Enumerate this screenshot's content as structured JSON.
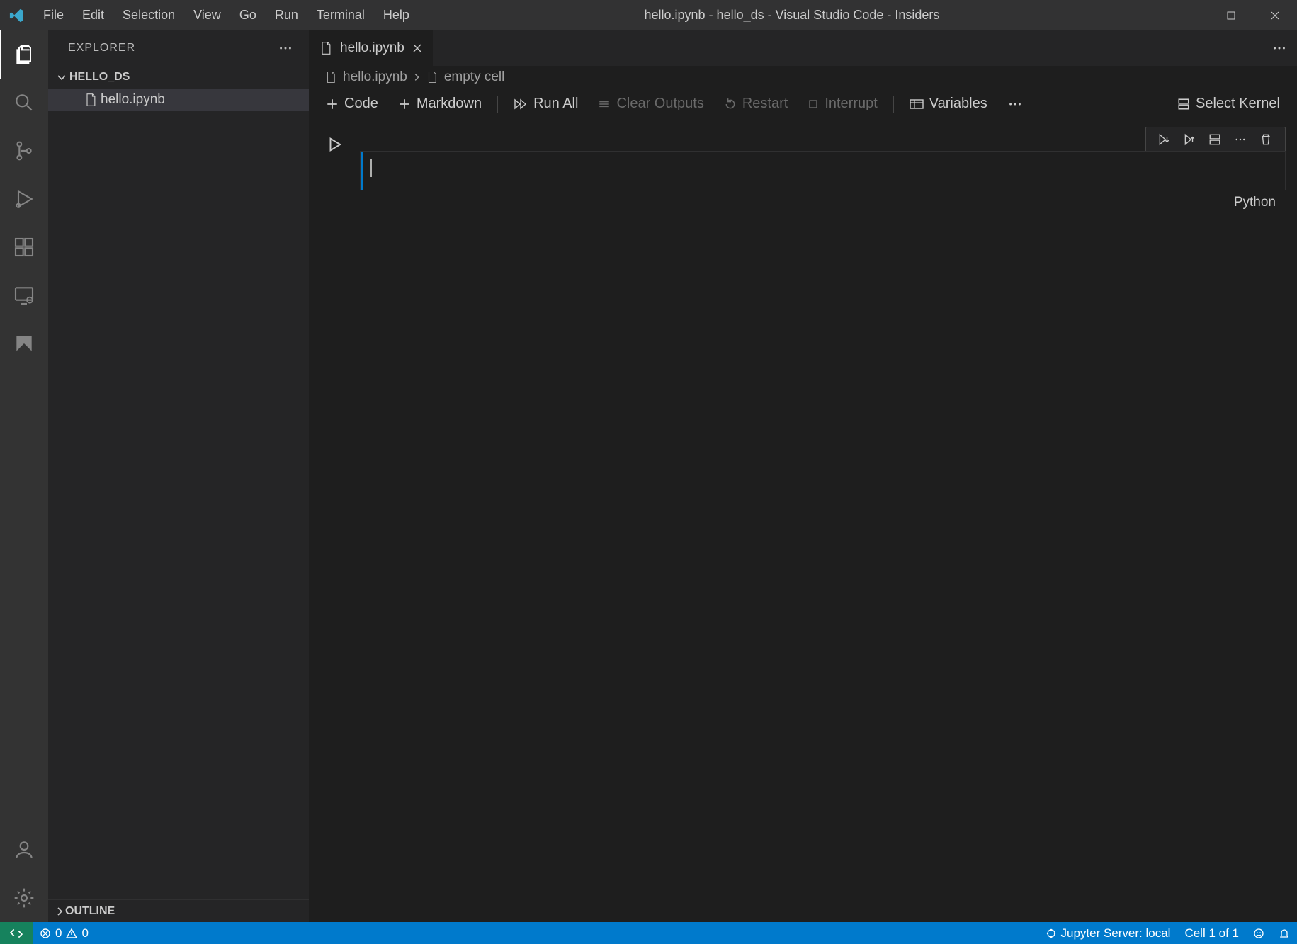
{
  "titlebar": {
    "menus": [
      "File",
      "Edit",
      "Selection",
      "View",
      "Go",
      "Run",
      "Terminal",
      "Help"
    ],
    "title": "hello.ipynb - hello_ds - Visual Studio Code - Insiders"
  },
  "sidebar": {
    "header": "EXPLORER",
    "folder": "HELLO_DS",
    "files": [
      "hello.ipynb"
    ],
    "outline": "OUTLINE"
  },
  "tab": {
    "label": "hello.ipynb"
  },
  "breadcrumb": {
    "file": "hello.ipynb",
    "cell": "empty cell"
  },
  "nbToolbar": {
    "code": "Code",
    "markdown": "Markdown",
    "runAll": "Run All",
    "clearOutputs": "Clear Outputs",
    "restart": "Restart",
    "interrupt": "Interrupt",
    "variables": "Variables",
    "selectKernel": "Select Kernel"
  },
  "cell": {
    "language": "Python"
  },
  "statusbar": {
    "errors": "0",
    "warnings": "0",
    "jupyter": "Jupyter Server: local",
    "cell": "Cell 1 of 1"
  }
}
